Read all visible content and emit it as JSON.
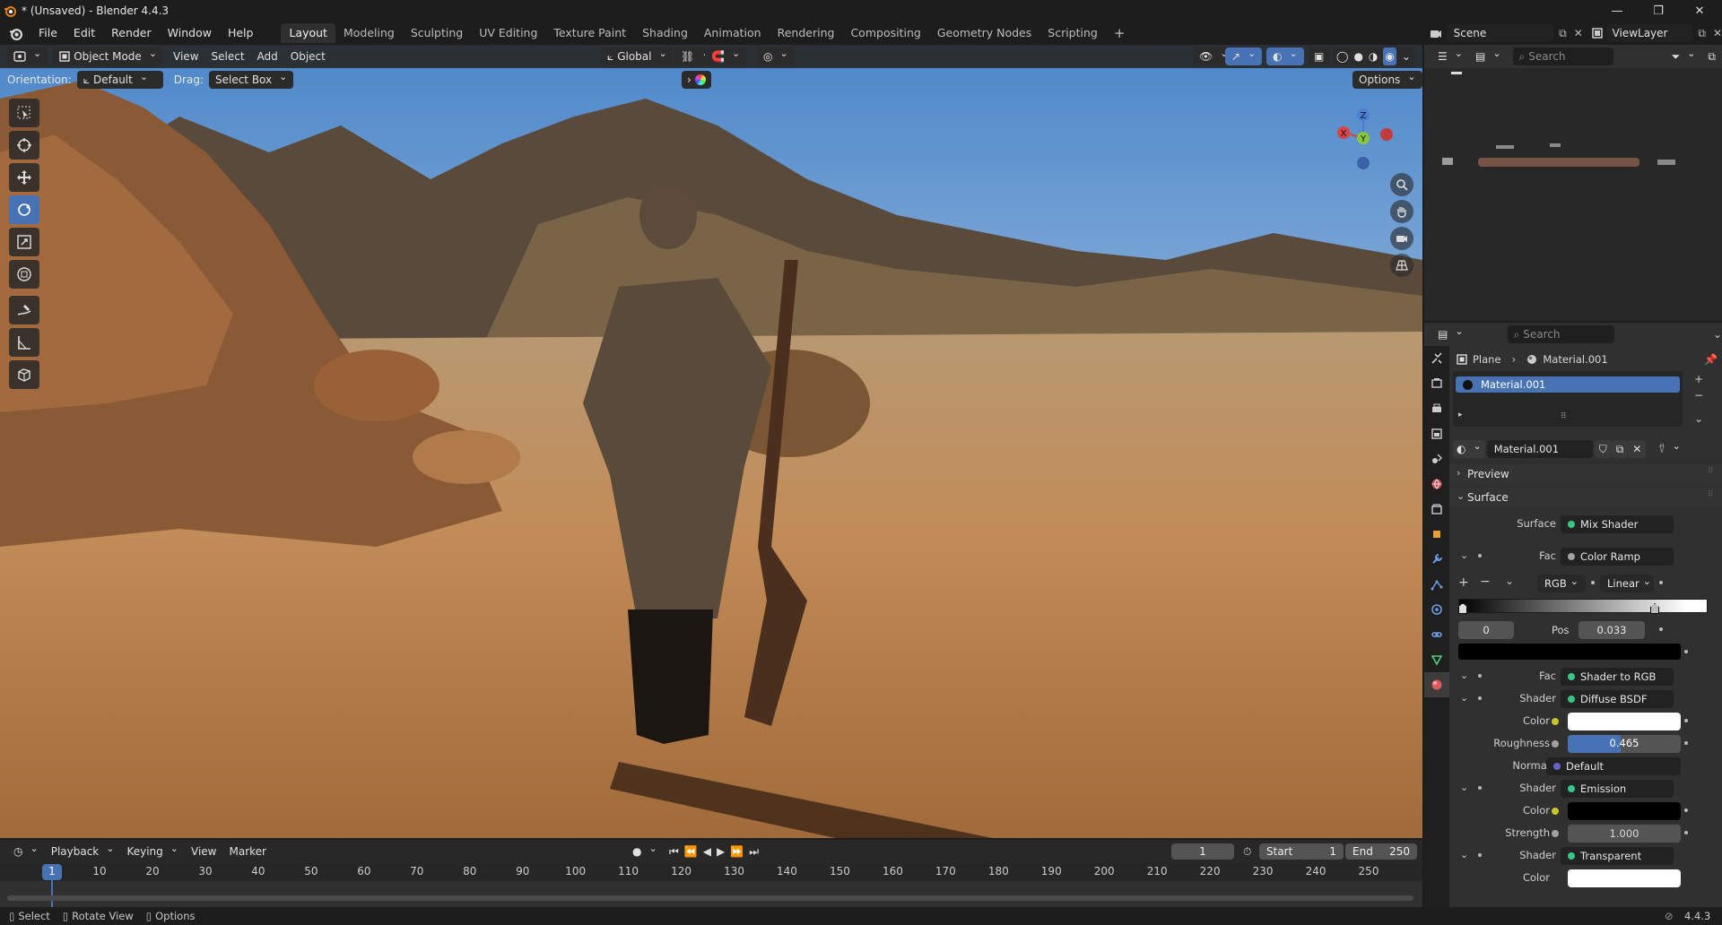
{
  "titlebar": {
    "title": "* (Unsaved) - Blender 4.4.3"
  },
  "menu": [
    "File",
    "Edit",
    "Render",
    "Window",
    "Help"
  ],
  "workspaces": [
    "Layout",
    "Modeling",
    "Sculpting",
    "UV Editing",
    "Texture Paint",
    "Shading",
    "Animation",
    "Rendering",
    "Compositing",
    "Geometry Nodes",
    "Scripting"
  ],
  "scene": {
    "label": "Scene",
    "viewlayer": "ViewLayer"
  },
  "viewport": {
    "mode": "Object Mode",
    "menus": [
      "View",
      "Select",
      "Add",
      "Object"
    ],
    "transform_orientation": "Global",
    "orientation_label": "Orientation:",
    "orientation_value": "Default",
    "drag_label": "Drag:",
    "drag_value": "Select Box",
    "options": "Options",
    "gizmo": {
      "z": "Z",
      "x": "X",
      "y": "Y"
    }
  },
  "timeline": {
    "menus": [
      "Playback",
      "Keying",
      "View",
      "Marker"
    ],
    "current_frame": "1",
    "start_label": "Start",
    "start": "1",
    "end_label": "End",
    "end": "250",
    "ticks": [
      "1",
      "10",
      "20",
      "30",
      "40",
      "50",
      "60",
      "70",
      "80",
      "90",
      "100",
      "110",
      "120",
      "130",
      "140",
      "150",
      "160",
      "170",
      "180",
      "190",
      "200",
      "210",
      "220",
      "230",
      "240",
      "250"
    ]
  },
  "statusbar": {
    "select": "Select",
    "rotate": "Rotate View",
    "options": "Options",
    "version": "4.4.3"
  },
  "outliner": {
    "search_placeholder": "Search"
  },
  "properties": {
    "search_placeholder": "Search",
    "breadcrumb_object": "Plane",
    "breadcrumb_material": "Material.001",
    "slot_name": "Material.001",
    "material_name": "Material.001",
    "preview": "Preview",
    "surface": "Surface",
    "rows": {
      "surface": {
        "label": "Surface",
        "value": "Mix Shader"
      },
      "fac1": {
        "label": "Fac",
        "value": "Color Ramp"
      },
      "ramp_mode": "RGB",
      "ramp_interp": "Linear",
      "ramp_index": "0",
      "pos_label": "Pos",
      "pos_value": "0.033",
      "fac2": {
        "label": "Fac",
        "value": "Shader to RGB"
      },
      "shader1": {
        "label": "Shader",
        "value": "Diffuse BSDF"
      },
      "color1": {
        "label": "Color"
      },
      "roughness": {
        "label": "Roughness",
        "value": "0.465",
        "fraction": 0.465
      },
      "normal": {
        "label": "Normal",
        "value": "Default"
      },
      "shader2": {
        "label": "Shader",
        "value": "Emission"
      },
      "color2": {
        "label": "Color"
      },
      "strength": {
        "label": "Strength",
        "value": "1.000"
      },
      "shader3": {
        "label": "Shader",
        "value": "Transparent BSDF"
      },
      "color3": {
        "label": "Color"
      }
    }
  },
  "colors": {
    "accent": "#4772b3",
    "socket_shader": "#39c884",
    "socket_color": "#c7c729",
    "socket_vector": "#6363c7",
    "socket_float": "#a1a1a1"
  }
}
